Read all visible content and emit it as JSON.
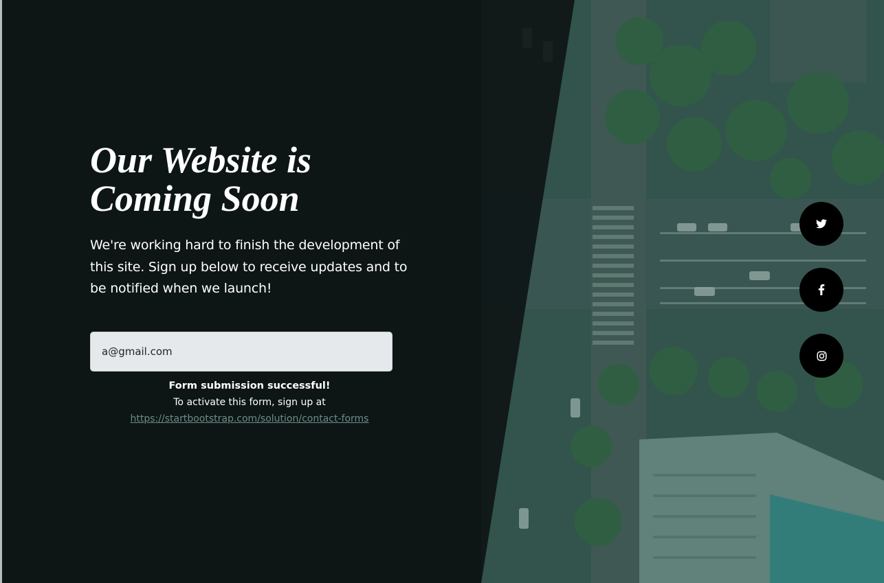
{
  "hero": {
    "title_line1": "Our Website is",
    "title_line2": "Coming Soon",
    "lead": "We're working hard to finish the development of this site. Sign up below to receive updates and to be notified when we launch!"
  },
  "signup_form": {
    "email_value": "a@gmail.com",
    "success_title": "Form submission successful!",
    "activate_text": "To activate this form, sign up at",
    "activate_link": "https://startbootstrap.com/solution/contact-forms"
  },
  "social_links": [
    {
      "icon": "twitter-icon"
    },
    {
      "icon": "facebook-icon"
    },
    {
      "icon": "instagram-icon"
    }
  ],
  "colors": {
    "overlay": "#0d1414",
    "button_bg": "#000000",
    "input_bg": "#e6e9ec",
    "link": "#6b8f8a"
  }
}
